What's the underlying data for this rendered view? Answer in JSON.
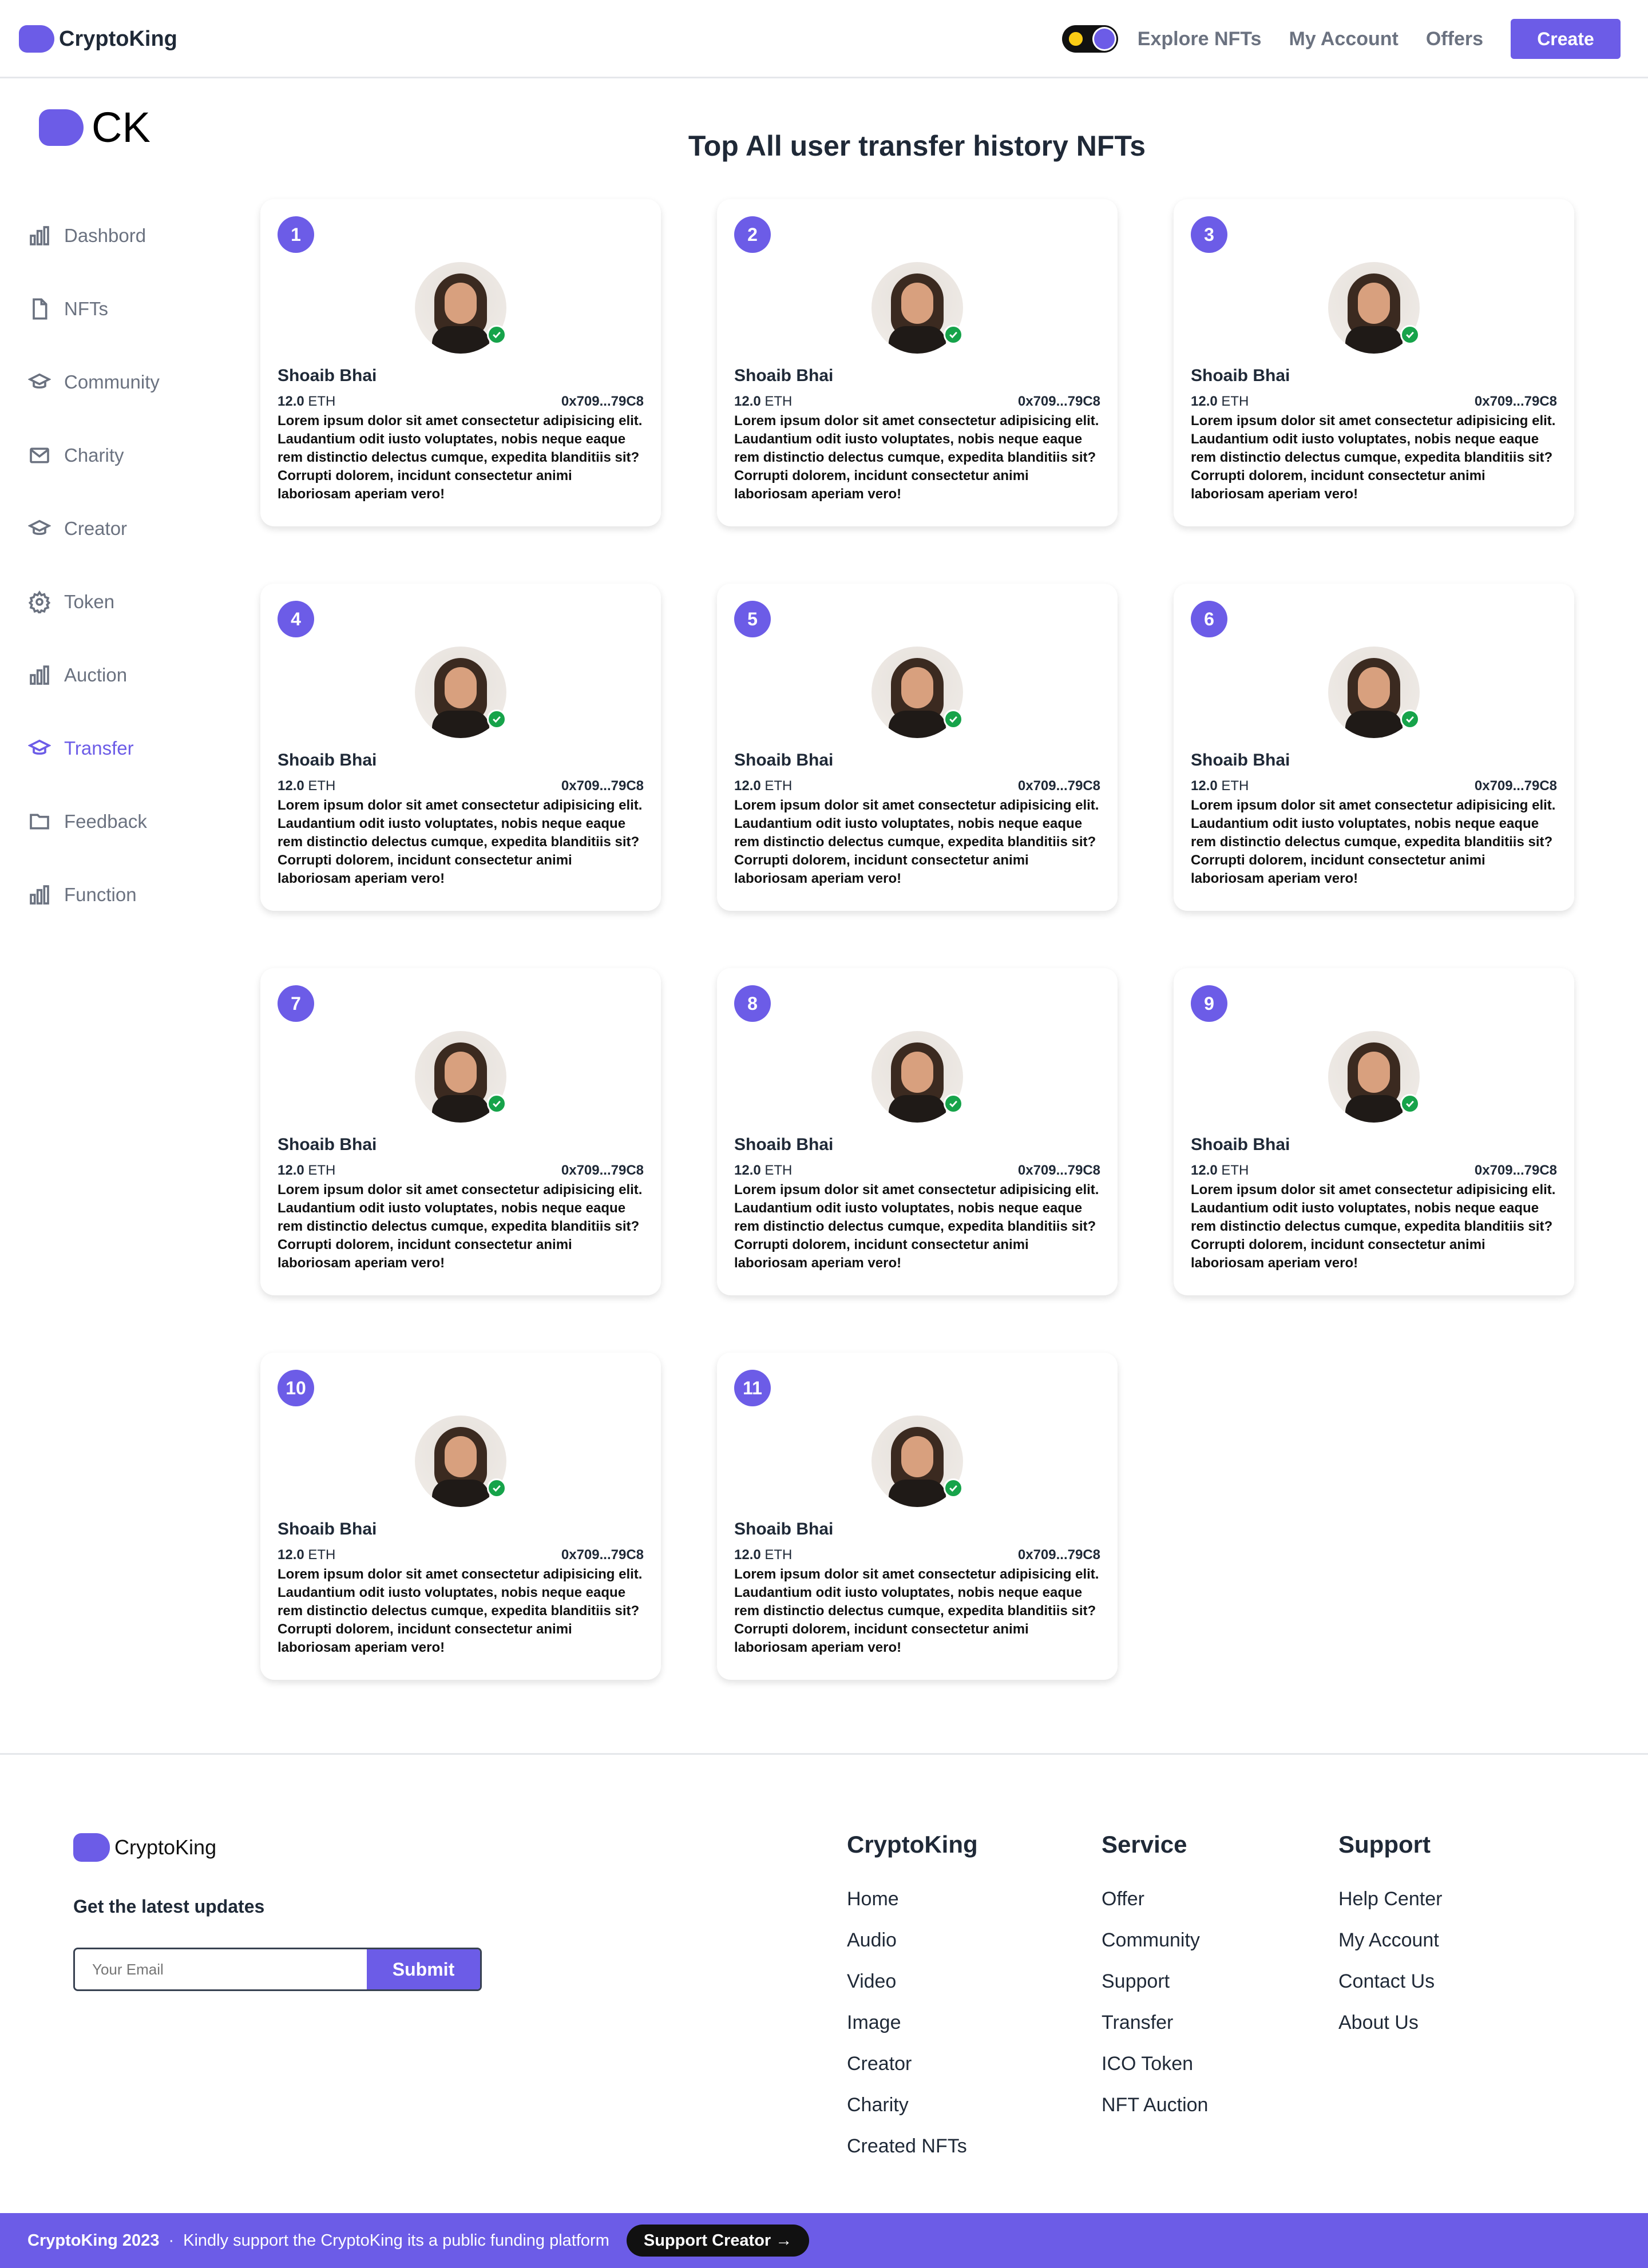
{
  "header": {
    "brand": "CryptoKing",
    "nav": [
      "Explore NFTs",
      "My Account",
      "Offers"
    ],
    "create_label": "Create"
  },
  "sidebar": {
    "brand_short": "CK",
    "items": [
      {
        "label": "Dashbord",
        "icon": "bar-chart-icon"
      },
      {
        "label": "NFTs",
        "icon": "file-icon"
      },
      {
        "label": "Community",
        "icon": "graduation-cap-icon"
      },
      {
        "label": "Charity",
        "icon": "mail-icon"
      },
      {
        "label": "Creator",
        "icon": "graduation-cap-icon"
      },
      {
        "label": "Token",
        "icon": "gear-icon"
      },
      {
        "label": "Auction",
        "icon": "bar-chart-icon"
      },
      {
        "label": "Transfer",
        "icon": "graduation-cap-icon",
        "active": true
      },
      {
        "label": "Feedback",
        "icon": "folder-icon"
      },
      {
        "label": "Function",
        "icon": "bar-chart-icon"
      }
    ]
  },
  "main": {
    "title": "Top All user transfer history NFTs",
    "cards": [
      {
        "rank": "1",
        "name": "Shoaib Bhai",
        "price": "12.0",
        "currency": "ETH",
        "address": "0x709...79C8",
        "description": "Lorem ipsum dolor sit amet consectetur adipisicing elit. Laudantium odit iusto voluptates, nobis neque eaque rem distinctio delectus cumque, expedita blanditiis sit? Corrupti dolorem, incidunt consectetur animi laboriosam aperiam vero!"
      },
      {
        "rank": "2",
        "name": "Shoaib Bhai",
        "price": "12.0",
        "currency": "ETH",
        "address": "0x709...79C8",
        "description": "Lorem ipsum dolor sit amet consectetur adipisicing elit. Laudantium odit iusto voluptates, nobis neque eaque rem distinctio delectus cumque, expedita blanditiis sit? Corrupti dolorem, incidunt consectetur animi laboriosam aperiam vero!"
      },
      {
        "rank": "3",
        "name": "Shoaib Bhai",
        "price": "12.0",
        "currency": "ETH",
        "address": "0x709...79C8",
        "description": "Lorem ipsum dolor sit amet consectetur adipisicing elit. Laudantium odit iusto voluptates, nobis neque eaque rem distinctio delectus cumque, expedita blanditiis sit? Corrupti dolorem, incidunt consectetur animi laboriosam aperiam vero!"
      },
      {
        "rank": "4",
        "name": "Shoaib Bhai",
        "price": "12.0",
        "currency": "ETH",
        "address": "0x709...79C8",
        "description": "Lorem ipsum dolor sit amet consectetur adipisicing elit. Laudantium odit iusto voluptates, nobis neque eaque rem distinctio delectus cumque, expedita blanditiis sit? Corrupti dolorem, incidunt consectetur animi laboriosam aperiam vero!"
      },
      {
        "rank": "5",
        "name": "Shoaib Bhai",
        "price": "12.0",
        "currency": "ETH",
        "address": "0x709...79C8",
        "description": "Lorem ipsum dolor sit amet consectetur adipisicing elit. Laudantium odit iusto voluptates, nobis neque eaque rem distinctio delectus cumque, expedita blanditiis sit? Corrupti dolorem, incidunt consectetur animi laboriosam aperiam vero!"
      },
      {
        "rank": "6",
        "name": "Shoaib Bhai",
        "price": "12.0",
        "currency": "ETH",
        "address": "0x709...79C8",
        "description": "Lorem ipsum dolor sit amet consectetur adipisicing elit. Laudantium odit iusto voluptates, nobis neque eaque rem distinctio delectus cumque, expedita blanditiis sit? Corrupti dolorem, incidunt consectetur animi laboriosam aperiam vero!"
      },
      {
        "rank": "7",
        "name": "Shoaib Bhai",
        "price": "12.0",
        "currency": "ETH",
        "address": "0x709...79C8",
        "description": "Lorem ipsum dolor sit amet consectetur adipisicing elit. Laudantium odit iusto voluptates, nobis neque eaque rem distinctio delectus cumque, expedita blanditiis sit? Corrupti dolorem, incidunt consectetur animi laboriosam aperiam vero!"
      },
      {
        "rank": "8",
        "name": "Shoaib Bhai",
        "price": "12.0",
        "currency": "ETH",
        "address": "0x709...79C8",
        "description": "Lorem ipsum dolor sit amet consectetur adipisicing elit. Laudantium odit iusto voluptates, nobis neque eaque rem distinctio delectus cumque, expedita blanditiis sit? Corrupti dolorem, incidunt consectetur animi laboriosam aperiam vero!"
      },
      {
        "rank": "9",
        "name": "Shoaib Bhai",
        "price": "12.0",
        "currency": "ETH",
        "address": "0x709...79C8",
        "description": "Lorem ipsum dolor sit amet consectetur adipisicing elit. Laudantium odit iusto voluptates, nobis neque eaque rem distinctio delectus cumque, expedita blanditiis sit? Corrupti dolorem, incidunt consectetur animi laboriosam aperiam vero!"
      },
      {
        "rank": "10",
        "name": "Shoaib Bhai",
        "price": "12.0",
        "currency": "ETH",
        "address": "0x709...79C8",
        "description": "Lorem ipsum dolor sit amet consectetur adipisicing elit. Laudantium odit iusto voluptates, nobis neque eaque rem distinctio delectus cumque, expedita blanditiis sit? Corrupti dolorem, incidunt consectetur animi laboriosam aperiam vero!"
      },
      {
        "rank": "11",
        "name": "Shoaib Bhai",
        "price": "12.0",
        "currency": "ETH",
        "address": "0x709...79C8",
        "description": "Lorem ipsum dolor sit amet consectetur adipisicing elit. Laudantium odit iusto voluptates, nobis neque eaque rem distinctio delectus cumque, expedita blanditiis sit? Corrupti dolorem, incidunt consectetur animi laboriosam aperiam vero!"
      }
    ]
  },
  "footer": {
    "brand": "CryptoKing",
    "updates_label": "Get the latest updates",
    "email_placeholder": "Your Email",
    "submit_label": "Submit",
    "columns": [
      {
        "title": "CryptoKing",
        "links": [
          "Home",
          "Audio",
          "Video",
          "Image",
          "Creator",
          "Charity",
          "Created NFTs"
        ]
      },
      {
        "title": "Service",
        "links": [
          "Offer",
          "Community",
          "Support",
          "Transfer",
          "ICO Token",
          "NFT Auction"
        ]
      },
      {
        "title": "Support",
        "links": [
          "Help Center",
          "My Account",
          "Contact Us",
          "About Us"
        ]
      }
    ]
  },
  "bottom_bar": {
    "copyright": "CryptoKing 2023",
    "separator": "·",
    "message": "Kindly support the CryptoKing its a public funding platform",
    "button_label": "Support Creator →"
  },
  "colors": {
    "accent": "#6c5ce7",
    "verified": "#16a34a",
    "toggle_sun": "#facc15"
  }
}
